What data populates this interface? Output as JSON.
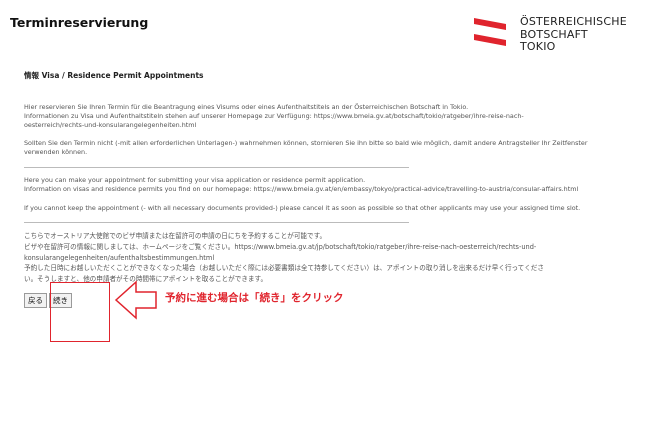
{
  "header": {
    "title": "Terminreservierung"
  },
  "logo": {
    "line1": "ÖSTERREICHISCHE",
    "line2": "BOTSCHAFT",
    "line3": "TOKIO",
    "brand_color": "#e0242d"
  },
  "section": {
    "title": "情報 Visa / Residence Permit Appointments"
  },
  "german": {
    "p1": "Hier reservieren Sie Ihren Termin für die Beantragung eines Visums oder eines Aufenthaltstitels an der Österreichischen Botschaft in Tokio.\nInformationen zu Visa und Aufenthaltstiteln stehen auf unserer Homepage zur Verfügung: https://www.bmeia.gv.at/botschaft/tokio/ratgeber/ihre-reise-nach-\noesterreich/rechts-und-konsularangelegenheiten.html",
    "p2": "Sollten Sie den Termin nicht (-mit allen erforderlichen Unterlagen-) wahrnehmen können, stornieren Sie ihn bitte so bald wie möglich, damit andere Antragsteller Ihr Zeitfenster\nverwenden können."
  },
  "english": {
    "p1": "Here you can make your appointment for submitting your visa application or residence permit application.\nInformation on visas and residence permits you find on our homepage: https://www.bmeia.gv.at/en/embassy/tokyo/practical-advice/travelling-to-austria/consular-affairs.html",
    "p2": "If you cannot keep the appointment (- with all necessary documents provided-) please cancel it as soon as possible so that other applicants may use your assigned time slot."
  },
  "japanese": {
    "p1": "こちらでオーストリア大使館でのビザ申請または在留許可の申請の日にちを予約することが可能です。\nビザや在留許可の情報に関しましては、ホームページをご覧ください。https://www.bmeia.gv.at/jp/botschaft/tokio/ratgeber/ihre-reise-nach-oesterreich/rechts-und-\nkonsularangelegenheiten/aufenthaltsbestimmungen.html\n予約した日時にお越しいただくことができなくなった場合（お越しいただく際には必要書類は全て持参してください）は、アポイントの取り消しを出来るだけ早く行ってくださ\nい。そうしますと、他の申請者がその時間帯にアポイントを取ることができます。"
  },
  "buttons": {
    "back_label": "戻る",
    "continue_label": "続き"
  },
  "annotation": {
    "text": "予約に進む場合は「続き」をクリック",
    "color": "#e0242d"
  }
}
